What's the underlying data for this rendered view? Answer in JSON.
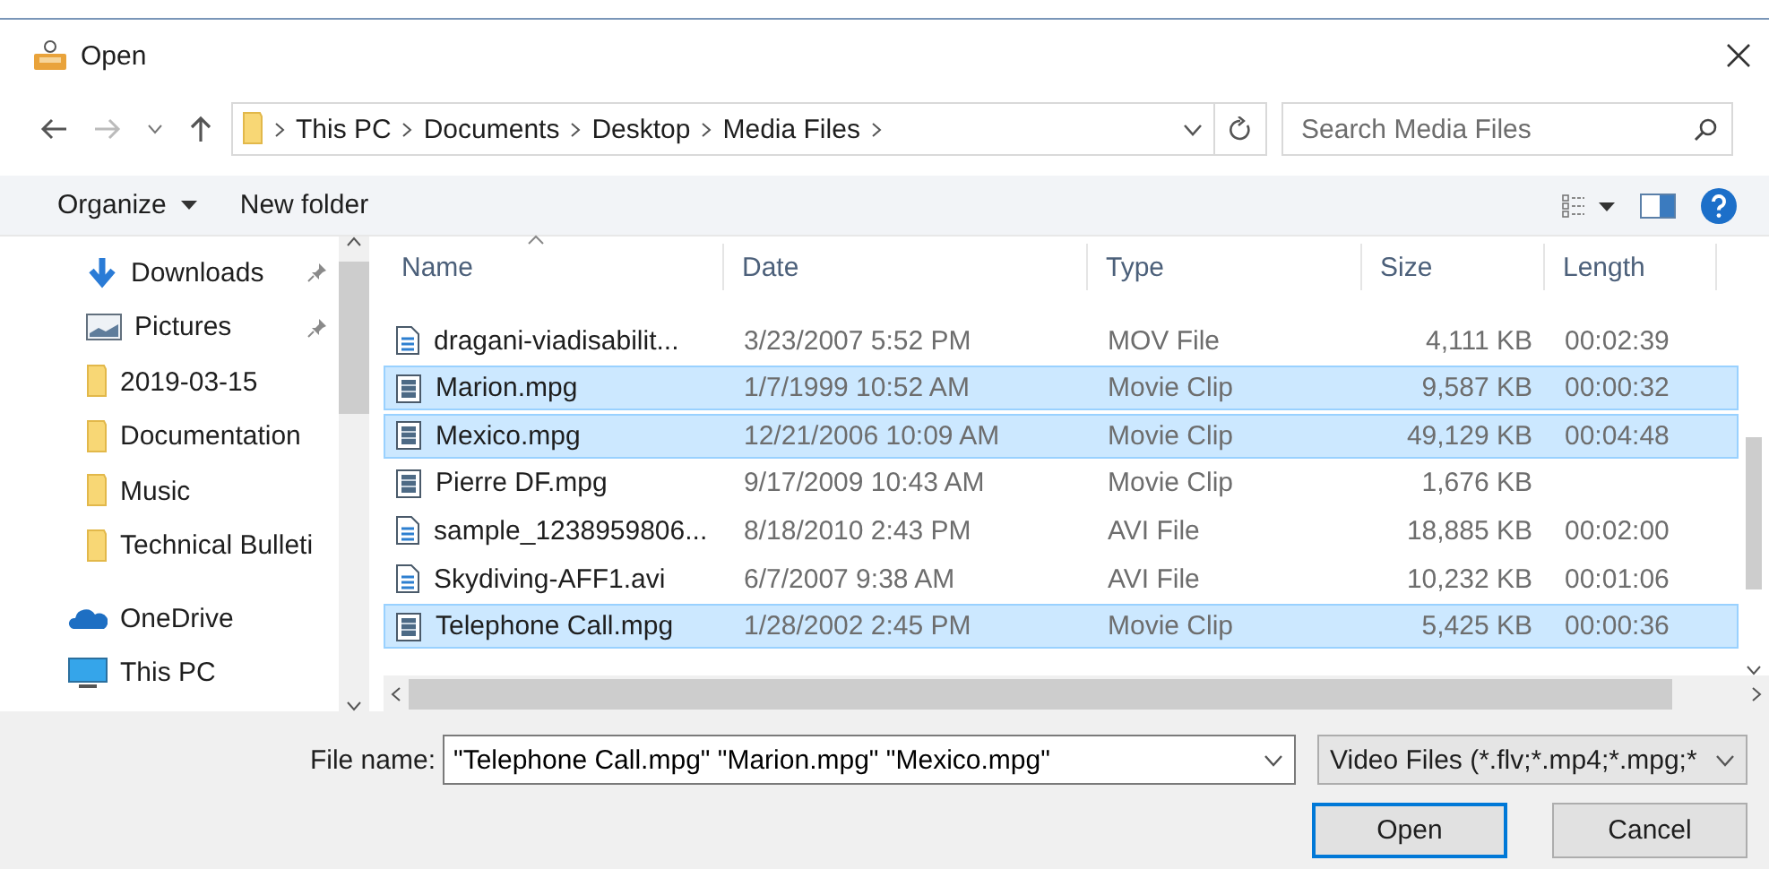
{
  "window": {
    "title": "Open"
  },
  "address": {
    "breadcrumbs": [
      "This PC",
      "Documents",
      "Desktop",
      "Media Files"
    ]
  },
  "search": {
    "placeholder": "Search Media Files"
  },
  "toolbar": {
    "organize": "Organize",
    "new_folder": "New folder"
  },
  "sidebar": {
    "pinned_items": [
      {
        "label": "Downloads",
        "kind": "downloads",
        "pinned": true
      },
      {
        "label": "Pictures",
        "kind": "pictures",
        "pinned": true
      },
      {
        "label": "2019-03-15",
        "kind": "folder",
        "pinned": false
      },
      {
        "label": "Documentation",
        "kind": "folder",
        "pinned": false
      },
      {
        "label": "Music",
        "kind": "folder",
        "pinned": false
      },
      {
        "label": "Technical Bulleti",
        "kind": "folder",
        "pinned": false
      }
    ],
    "locations": [
      {
        "label": "OneDrive",
        "kind": "cloud"
      },
      {
        "label": "This PC",
        "kind": "computer"
      }
    ]
  },
  "files": {
    "columns": [
      "Name",
      "Date",
      "Type",
      "Size",
      "Length"
    ],
    "rows": [
      {
        "name": "dragani-viadisabilit...",
        "date": "3/23/2007 5:52 PM",
        "type": "MOV File",
        "size": "4,111 KB",
        "length": "00:02:39",
        "kind": "document",
        "selected": false
      },
      {
        "name": "Marion.mpg",
        "date": "1/7/1999 10:52 AM",
        "type": "Movie Clip",
        "size": "9,587 KB",
        "length": "00:00:32",
        "kind": "movie",
        "selected": true
      },
      {
        "name": "Mexico.mpg",
        "date": "12/21/2006 10:09 AM",
        "type": "Movie Clip",
        "size": "49,129 KB",
        "length": "00:04:48",
        "kind": "movie",
        "selected": true
      },
      {
        "name": "Pierre DF.mpg",
        "date": "9/17/2009 10:43 AM",
        "type": "Movie Clip",
        "size": "1,676 KB",
        "kind": "movie",
        "selected": false
      },
      {
        "name": "sample_1238959806...",
        "date": "8/18/2010 2:43 PM",
        "type": "AVI File",
        "size": "18,885 KB",
        "length": "00:02:00",
        "kind": "document",
        "selected": false
      },
      {
        "name": "Skydiving-AFF1.avi",
        "date": "6/7/2007 9:38 AM",
        "type": "AVI File",
        "size": "10,232 KB",
        "length": "00:01:06",
        "kind": "document",
        "selected": false
      },
      {
        "name": "Telephone Call.mpg",
        "date": "1/28/2002 2:45 PM",
        "type": "Movie Clip",
        "size": "5,425 KB",
        "length": "00:00:36",
        "kind": "movie",
        "selected": true
      }
    ]
  },
  "footer": {
    "file_name_label": "File name:",
    "file_name": "\"Telephone Call.mpg\" \"Marion.mpg\" \"Mexico.mpg\"",
    "filter": "Video Files (*.flv;*.mp4;*.mpg;*",
    "buttons": [
      {
        "label": "Open",
        "default": true
      },
      {
        "label": "Cancel",
        "default": false
      }
    ]
  }
}
